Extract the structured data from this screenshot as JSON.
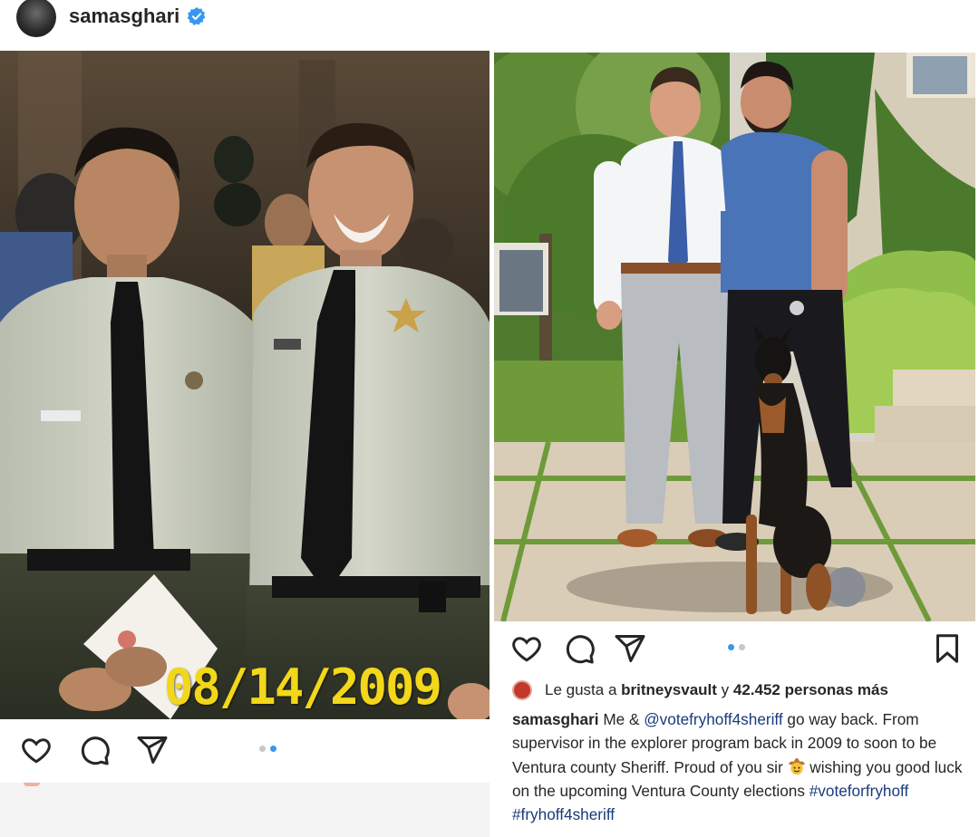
{
  "left_post": {
    "username": "samasghari",
    "photo_date_stamp": "08/14/2009",
    "carousel": {
      "count": 2,
      "active_index": 1
    },
    "icons": [
      "heart-icon",
      "comment-icon",
      "share-icon"
    ]
  },
  "right_post": {
    "carousel": {
      "count": 2,
      "active_index": 0
    },
    "icons": [
      "heart-icon",
      "comment-icon",
      "share-icon",
      "bookmark-icon"
    ],
    "likes": {
      "prefix": "Le gusta a ",
      "user": "britneysvault",
      "middle": " y ",
      "others": "42.452 personas más"
    },
    "caption": {
      "username": "samasghari",
      "part1": " Me & ",
      "mention": "@votefryhoff4sheriff",
      "part2": " go way back. From supervisor in the explorer program back in 2009 to soon to be Ventura county Sheriff. Proud of you sir ",
      "emoji": "cowboy-face-icon",
      "part3": " wishing you good luck on the upcoming Ventura County elections ",
      "hashtag1": "#voteforfryhoff",
      "hashtag2": "#fryhoff4sheriff"
    }
  },
  "colors": {
    "text": "#262626",
    "verified_blue": "#3897f0",
    "link_blue": "#1a3a7a",
    "date_stamp_yellow": "#f2d71a"
  }
}
